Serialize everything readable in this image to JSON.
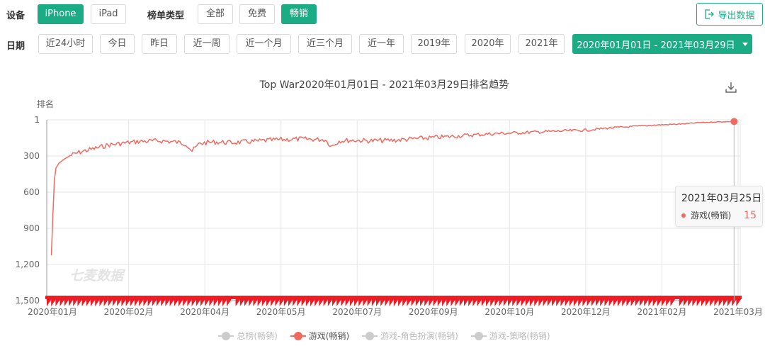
{
  "filters": {
    "device": {
      "label": "设备",
      "options": [
        {
          "label": "iPhone",
          "active": true
        },
        {
          "label": "iPad",
          "active": false
        }
      ]
    },
    "chart_type": {
      "label": "榜单类型",
      "options": [
        {
          "label": "全部",
          "active": false
        },
        {
          "label": "免费",
          "active": false
        },
        {
          "label": "畅销",
          "active": true
        }
      ]
    },
    "date": {
      "label": "日期",
      "options": [
        {
          "label": "近24小时"
        },
        {
          "label": "今日"
        },
        {
          "label": "昨日"
        },
        {
          "label": "近一周"
        },
        {
          "label": "近一个月"
        },
        {
          "label": "近三个月"
        },
        {
          "label": "近一年"
        },
        {
          "label": "2019年"
        },
        {
          "label": "2020年"
        },
        {
          "label": "2021年"
        }
      ],
      "range_value": "2020年01月01日 - 2021年03月29日"
    }
  },
  "toolbar": {
    "export_label": "导出数据"
  },
  "colors": {
    "accent": "#1cac85",
    "series": "#f06a60",
    "axis": "#666666",
    "grid": "#e6e6e6"
  },
  "chart_data": {
    "type": "line",
    "title": "Top War2020年01月01日 - 2021年03月29日排名趋势",
    "ylabel": "排名",
    "ylim": [
      1,
      1500
    ],
    "y_inverted": true,
    "y_ticks": [
      "1",
      "300",
      "600",
      "900",
      "1,200",
      "1,500"
    ],
    "x_range": [
      "2020-01-01",
      "2021-03-29"
    ],
    "x_tick_labels": [
      "2020年01月",
      "2020年02月",
      "2020年04月",
      "2020年05月",
      "2020年07月",
      "2020年09月",
      "2020年10月",
      "2020年12月",
      "2021年02月",
      "2021年03月"
    ],
    "grid": true,
    "watermark": "七麦数据",
    "legend_position": "bottom",
    "series": [
      {
        "name": "游戏(畅销)",
        "points": [
          [
            "2020-01-04",
            1125
          ],
          [
            "2020-01-05",
            800
          ],
          [
            "2020-01-06",
            500
          ],
          [
            "2020-01-07",
            400
          ],
          [
            "2020-01-09",
            360
          ],
          [
            "2020-01-12",
            330
          ],
          [
            "2020-01-16",
            300
          ],
          [
            "2020-01-20",
            280
          ],
          [
            "2020-01-25",
            260
          ],
          [
            "2020-02-01",
            240
          ],
          [
            "2020-02-10",
            210
          ],
          [
            "2020-02-20",
            195
          ],
          [
            "2020-03-01",
            180
          ],
          [
            "2020-03-15",
            175
          ],
          [
            "2020-03-25",
            185
          ],
          [
            "2020-04-01",
            200
          ],
          [
            "2020-04-05",
            260
          ],
          [
            "2020-04-10",
            195
          ],
          [
            "2020-04-20",
            185
          ],
          [
            "2020-05-01",
            190
          ],
          [
            "2020-05-15",
            180
          ],
          [
            "2020-06-01",
            165
          ],
          [
            "2020-06-15",
            160
          ],
          [
            "2020-07-01",
            165
          ],
          [
            "2020-07-05",
            220
          ],
          [
            "2020-07-10",
            175
          ],
          [
            "2020-07-20",
            170
          ],
          [
            "2020-08-01",
            175
          ],
          [
            "2020-08-15",
            170
          ],
          [
            "2020-09-01",
            155
          ],
          [
            "2020-09-20",
            140
          ],
          [
            "2020-10-01",
            130
          ],
          [
            "2020-10-20",
            115
          ],
          [
            "2020-11-01",
            110
          ],
          [
            "2020-11-20",
            100
          ],
          [
            "2020-12-01",
            95
          ],
          [
            "2020-12-20",
            85
          ],
          [
            "2021-01-01",
            70
          ],
          [
            "2021-01-20",
            55
          ],
          [
            "2021-02-01",
            45
          ],
          [
            "2021-02-20",
            35
          ],
          [
            "2021-03-01",
            25
          ],
          [
            "2021-03-15",
            18
          ],
          [
            "2021-03-25",
            15
          ]
        ]
      }
    ],
    "tooltip": {
      "date": "2021年03月25日",
      "series": "游戏(畅销)",
      "value": "15"
    },
    "legend": [
      {
        "name": "总榜(畅销)",
        "active": false
      },
      {
        "name": "游戏(畅销)",
        "active": true
      },
      {
        "name": "游戏-角色扮演(畅销)",
        "active": false
      },
      {
        "name": "游戏-策略(畅销)",
        "active": false
      }
    ]
  }
}
